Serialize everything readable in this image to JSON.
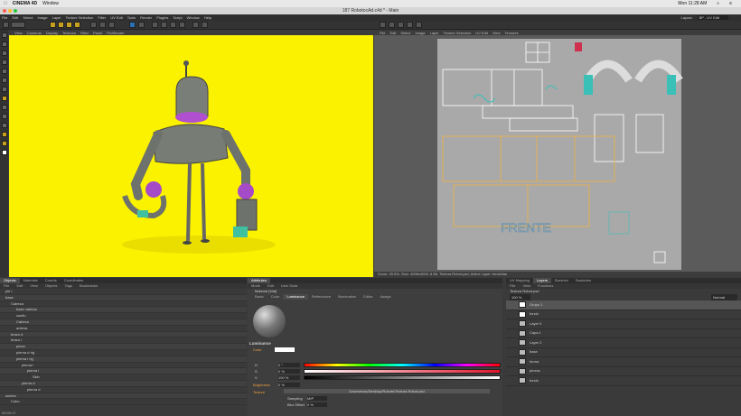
{
  "os_menu": {
    "apple": "",
    "app": "CINEMA 4D",
    "window": "Window",
    "right": [
      "Mon 11:28 AM"
    ]
  },
  "window_title": "187 RobotocAd.c4d * - Main",
  "menu": [
    "File",
    "Edit",
    "Select",
    "Image",
    "Layer",
    "Texture Selection",
    "Filter",
    "UV Edit",
    "Tools",
    "Render",
    "Plugins",
    "Script",
    "Window",
    "Help"
  ],
  "layout": {
    "label": "Layout:",
    "value": "BP - UV Edit"
  },
  "viewport": {
    "menu": [
      "View",
      "Cameras",
      "Display",
      "Textures",
      "Filter",
      "Panel",
      "ProRender"
    ]
  },
  "uv": {
    "menu": [
      "File",
      "Edit",
      "Select",
      "Image",
      "Layer",
      "Texture Selection",
      "UV Edit",
      "View",
      "Textures"
    ],
    "status": "Zoom: 25.9%, Size: 4096x4000, 8 Bit, Textura Robot.psd, Active Layer: fondo/las",
    "frente": "FRENTE"
  },
  "objects": {
    "tabs": [
      "Objects",
      "Materials",
      "Coords",
      "Coordinates"
    ],
    "menu": [
      "File",
      "Edit",
      "View",
      "Objects",
      "Tags",
      "Bookmarks"
    ],
    "rows": [
      "pie i",
      "base",
      "Cabeza",
      "base cabeza",
      "cuello",
      "Cabeza",
      "antena",
      "brazo d",
      "brazo i",
      "pinza",
      "pierna d rig",
      "pierna i rig",
      "pierna i",
      "pierna i",
      "Skin",
      "pierna d",
      "pierna d",
      "suelos",
      "Cubo"
    ]
  },
  "attributes": {
    "tab": "Attributes",
    "menu": [
      "Mode",
      "Edit",
      "User Data"
    ],
    "object": "Material [Mat]",
    "tabs": [
      "Basic",
      "Color",
      "Luminance",
      "Reflectance",
      "Illumination",
      "Editor",
      "Assign"
    ],
    "active_tab": "Luminance",
    "section": "Luminance",
    "color_label": "Color",
    "h_label": "H",
    "h_value": "0 °",
    "s_label": "S",
    "s_value": "0 %",
    "v_label": "V",
    "v_value": "100 %",
    "brightness_label": "Brightness",
    "brightness_value": "0 %",
    "texture_label": "Texture",
    "texture_path": "/Users/mac/Desktop/Robots/Textura Robot.psd",
    "sampling_label": "Sampling",
    "sampling_value": "MIP",
    "blur_label": "Blur Offset",
    "blur_value": "0 %"
  },
  "layers": {
    "tabs": [
      "UV Mapping",
      "Layers",
      "Brushes",
      "Swatches"
    ],
    "active_tab": "Layers",
    "menu": [
      "File",
      "View",
      "Functions"
    ],
    "file": "Textura Robot.psd",
    "zoom": "100 %",
    "mode": "Normal",
    "rows": [
      "Grupo 1",
      "fondo",
      "Layer 0",
      "Capa 1",
      "Layer 2",
      "base",
      "forma",
      "pinzas",
      "fondo"
    ]
  },
  "status": "00:00:17"
}
